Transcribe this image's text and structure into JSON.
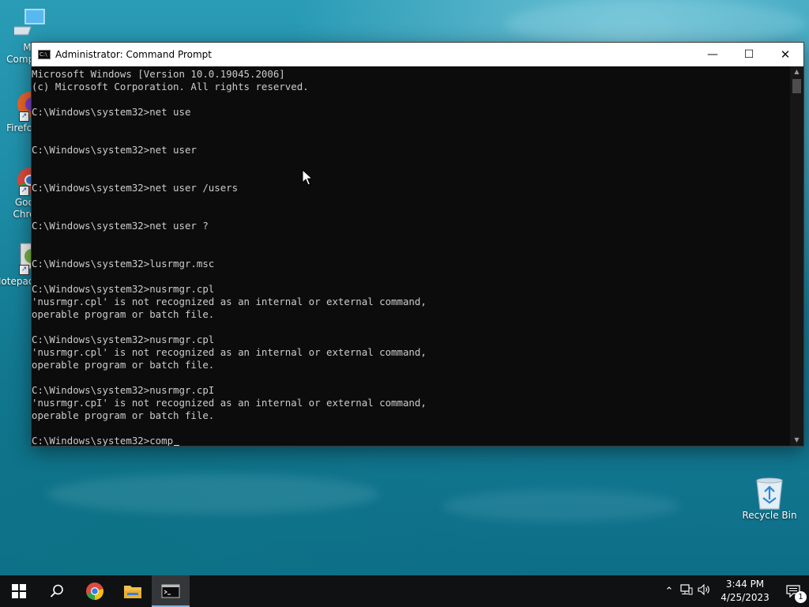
{
  "desktop": {
    "icons": [
      {
        "label": "My Computer",
        "icon": "my-computer-icon"
      },
      {
        "label": "Firefox",
        "icon": "firefox-icon"
      },
      {
        "label": "Google Chrome",
        "icon": "chrome-icon"
      },
      {
        "label": "Notepad++",
        "icon": "notepad-icon"
      },
      {
        "label": "Recycle Bin",
        "icon": "recycle-bin-icon"
      }
    ]
  },
  "window": {
    "title": "Administrator: Command Prompt",
    "minimize": "—",
    "maximize": "☐",
    "close": "✕",
    "console_lines": [
      "Microsoft Windows [Version 10.0.19045.2006]",
      "(c) Microsoft Corporation. All rights reserved.",
      "",
      "C:\\Windows\\system32>net use",
      "",
      "",
      "C:\\Windows\\system32>net user",
      "",
      "",
      "C:\\Windows\\system32>net user /users",
      "",
      "",
      "C:\\Windows\\system32>net user ?",
      "",
      "",
      "C:\\Windows\\system32>lusrmgr.msc",
      "",
      "C:\\Windows\\system32>nusrmgr.cpl",
      "'nusrmgr.cpl' is not recognized as an internal or external command,",
      "operable program or batch file.",
      "",
      "C:\\Windows\\system32>nusrmgr.cpl",
      "'nusrmgr.cpl' is not recognized as an internal or external command,",
      "operable program or batch file.",
      "",
      "C:\\Windows\\system32>nusrmgr.cpI",
      "'nusrmgr.cpI' is not recognized as an internal or external command,",
      "operable program or batch file.",
      ""
    ],
    "prompt": "C:\\Windows\\system32>",
    "current_input": "comp"
  },
  "taskbar": {
    "clock_time": "3:44 PM",
    "clock_date": "4/25/2023",
    "notification_count": "1",
    "colors": {
      "background": "#0f1113",
      "active_indicator": "#7cb3e8"
    }
  }
}
